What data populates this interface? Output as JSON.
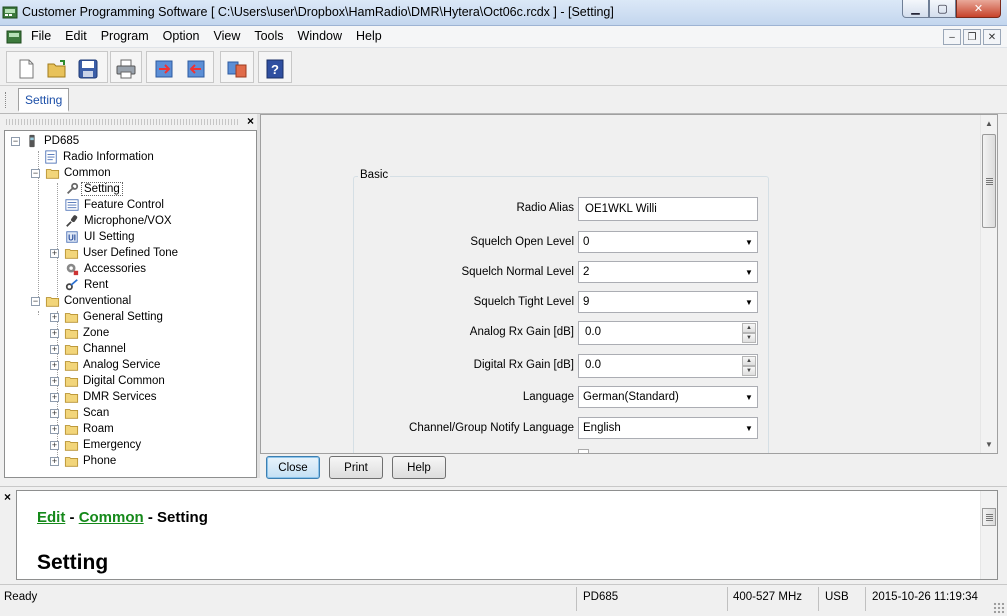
{
  "window": {
    "title": "Customer Programming Software [ C:\\Users\\user\\Dropbox\\HamRadio\\DMR\\Hytera\\Oct06c.rcdx ] - [Setting]",
    "minimize": "▁",
    "maximize": "▢",
    "close": "✕"
  },
  "menubar": {
    "items": [
      "File",
      "Edit",
      "Program",
      "Option",
      "View",
      "Tools",
      "Window",
      "Help"
    ],
    "mdi_minimize": "–",
    "mdi_restore": "❐",
    "mdi_close": "✕"
  },
  "toolbar": {
    "buttons": [
      "new-icon",
      "open-folder-icon",
      "save-icon",
      "print-icon",
      "read-radio-icon",
      "write-radio-icon",
      "clone-icon",
      "help-icon"
    ]
  },
  "tabs": {
    "active": "Setting"
  },
  "tree": {
    "close": "×",
    "root": "PD685",
    "items": {
      "radio_information": "Radio Information",
      "common": "Common",
      "setting": "Setting",
      "feature_control": "Feature Control",
      "microphone_vox": "Microphone/VOX",
      "ui_setting": "UI Setting",
      "user_defined_tone": "User Defined Tone",
      "accessories": "Accessories",
      "rent": "Rent",
      "conventional": "Conventional",
      "general_setting": "General Setting",
      "zone": "Zone",
      "channel": "Channel",
      "analog_service": "Analog Service",
      "digital_common": "Digital Common",
      "dmr_services": "DMR Services",
      "scan": "Scan",
      "roam": "Roam",
      "emergency": "Emergency",
      "phone": "Phone"
    }
  },
  "form": {
    "group": "Basic",
    "radio_alias": {
      "label": "Radio Alias",
      "value": "OE1WKL Willi"
    },
    "squelch_open": {
      "label": "Squelch Open Level",
      "value": "0"
    },
    "squelch_normal": {
      "label": "Squelch Normal Level",
      "value": "2"
    },
    "squelch_tight": {
      "label": "Squelch Tight Level",
      "value": "9"
    },
    "analog_rx_gain": {
      "label": "Analog Rx Gain [dB]",
      "value": "0.0"
    },
    "digital_rx_gain": {
      "label": "Digital Rx Gain [dB]",
      "value": "0.0"
    },
    "language": {
      "label": "Language",
      "value": "German(Standard)"
    },
    "notify_language": {
      "label": "Channel/Group Notify Language",
      "value": "English"
    }
  },
  "buttons": {
    "close": "Close",
    "print": "Print",
    "help": "Help"
  },
  "help": {
    "close": "×",
    "crumb_edit": "Edit",
    "sep1": " - ",
    "crumb_common": "Common",
    "sep2": " - ",
    "crumb_current": "Setting",
    "title": "Setting"
  },
  "status": {
    "state": "Ready",
    "model": "PD685",
    "band": "400-527 MHz",
    "port": "USB",
    "datetime": "2015-10-26 11:19:34"
  }
}
